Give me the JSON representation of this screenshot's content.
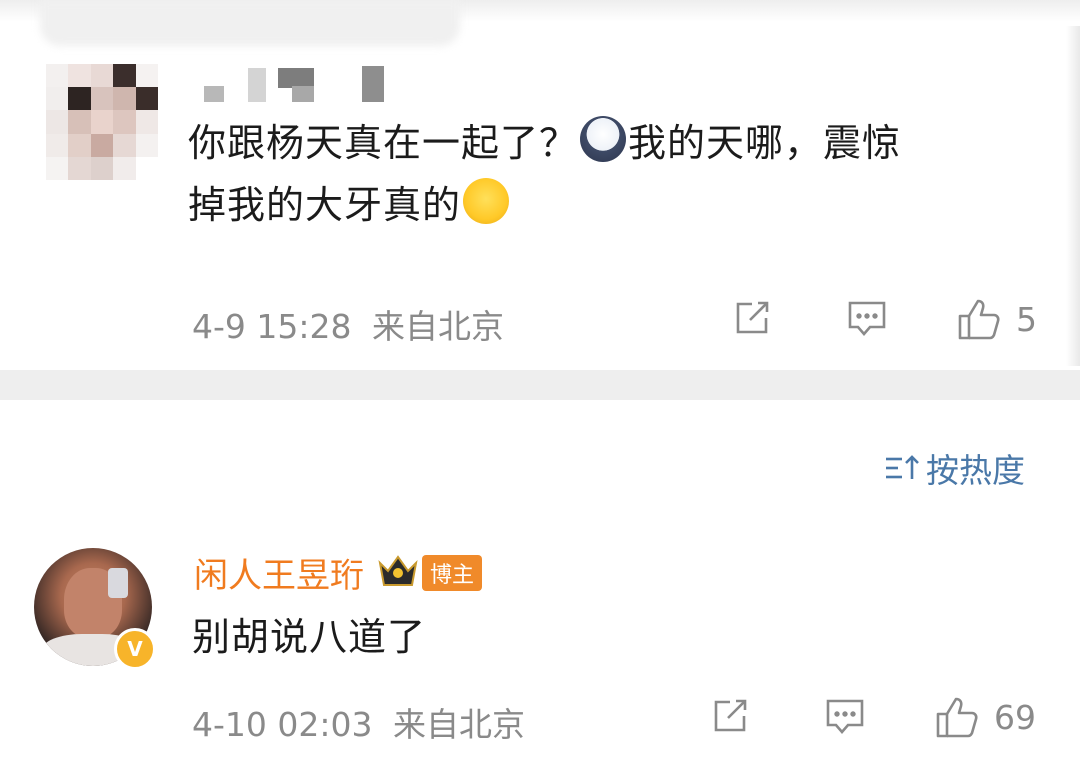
{
  "comments": [
    {
      "username": "",
      "text_line1_a": "你跟杨天真在一起了？",
      "emoji1": "scared-emoji",
      "text_line1_b": "我的天哪，震惊",
      "text_line2": "掉我的大牙真的",
      "emoji2": "laugh-cry-emoji",
      "time": "4-9 15:28",
      "location": "来自北京",
      "likes": "5"
    },
    {
      "username": "闲人王昱珩",
      "badge": "博主",
      "text": "别胡说八道了",
      "time": "4-10 02:03",
      "location": "来自北京",
      "likes": "69"
    }
  ],
  "sort": {
    "label": "按热度",
    "icon": "sort-icon"
  },
  "icons": {
    "share": "share-icon",
    "reply": "comment-icon",
    "like": "thumbs-up-icon",
    "crown": "crown-icon",
    "verified": "verified-v-icon"
  },
  "colors": {
    "username": "#f07b1f",
    "sort": "#4a78a8",
    "meta": "#8a8a8a",
    "divider": "#eeeeee"
  }
}
